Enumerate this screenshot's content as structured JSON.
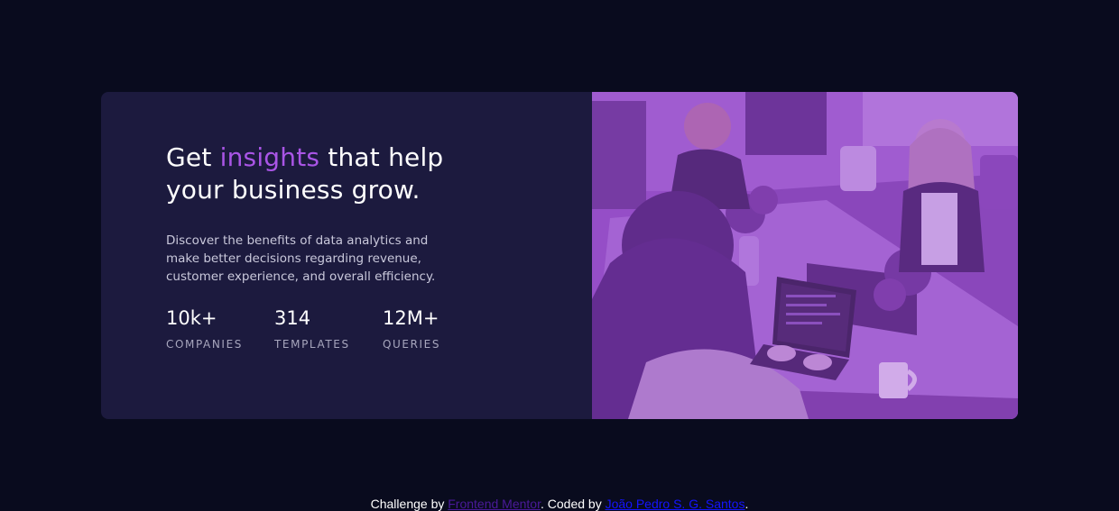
{
  "card": {
    "headline": {
      "before": "Get ",
      "highlight": "insights",
      "after": " that help your business grow."
    },
    "description": "Discover the benefits of data analytics and make better decisions regarding revenue, customer experience, and overall efficiency.",
    "stats": [
      {
        "value": "10k+",
        "label": "COMPANIES"
      },
      {
        "value": "314",
        "label": "TEMPLATES"
      },
      {
        "value": "12M+",
        "label": "QUERIES"
      }
    ],
    "image": {
      "description": "",
      "overlay_color": "#aa5cdb"
    }
  },
  "footer": {
    "prefix": "Challenge by ",
    "challenge_link": "Frontend Mentor",
    "middle": ". Coded by ",
    "author_link": "João Pedro S. G. Santos",
    "suffix": "."
  },
  "colors": {
    "background": "#090b1e",
    "card": "#1c1a3e",
    "accent": "#a955e6",
    "text_muted": "#c9c8db"
  }
}
